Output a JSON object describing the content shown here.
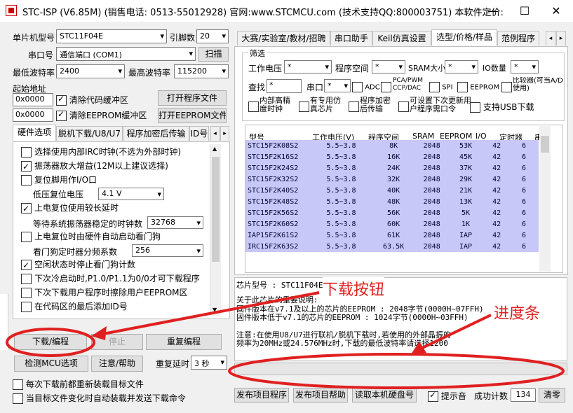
{
  "window": {
    "title": "STC-ISP (V6.85M) (销售电话: 0513-55012928) 官网:www.STCMCU.com (技术支持QQ:800003751) 本软件定价:",
    "min": "—",
    "max": "☐",
    "close": "✕"
  },
  "left": {
    "mcu_label": "单片机型号",
    "mcu_value": "STC11F04E",
    "pins_label": "引脚数",
    "pins_value": "20",
    "port_label": "串口号",
    "port_value": "通信端口 (COM1)",
    "scan": "扫描",
    "min_baud_label": "最低波特率",
    "min_baud_value": "2400",
    "max_baud_label": "最高波特率",
    "max_baud_value": "115200",
    "start_addr_label": "起始地址",
    "addr1": "0x0000",
    "clear_code": "清除代码缓冲区",
    "open_prog": "打开程序文件",
    "addr2": "0x0000",
    "clear_eeprom": "清除EEPROM缓冲区",
    "open_eeprom": "打开EEPROM文件",
    "tabs": [
      "硬件选项",
      "脱机下载/U8/U7",
      "程序加密后传输",
      "ID号"
    ],
    "options": [
      {
        "text": "选择使用内部IRC时钟(不选为外部时钟)",
        "checked": false
      },
      {
        "text": "振荡器放大增益(12M以上建议选择)",
        "checked": true
      },
      {
        "text": "复位脚用作I/O口",
        "checked": false
      },
      {
        "text": "上电复位使用较长延时",
        "checked": true
      },
      {
        "text": "上电复位时由硬件自动启动看门狗",
        "checked": false
      },
      {
        "text": "空闲状态时停止看门狗计数",
        "checked": true
      },
      {
        "text": "下次冷启动时,P1.0/P1.1为0/0才可下载程序",
        "checked": false
      },
      {
        "text": "下次下载用户程序时擦除用户EEPROM区",
        "checked": false
      },
      {
        "text": "在代码区的最后添加ID号",
        "checked": false
      }
    ],
    "low_reset_label": "低压复位电压",
    "low_reset_value": "4.1 V",
    "wait_label": "等待系统振荡器稳定的时钟数",
    "wait_value": "32768",
    "wdt_label": "看门狗定时器分频系数",
    "wdt_value": "256",
    "download": "下载/编程",
    "stop": "停止",
    "reprogram": "重复编程",
    "detect": "检测MCU选项",
    "help": "注意/帮助",
    "delay_label": "重复延时",
    "delay_value": "3 秒",
    "reload_each": "每次下载前都重新装载目标文件",
    "auto_download": "当目标文件变化时自动装载并发送下载命令"
  },
  "right": {
    "tabs": [
      "大赛/实验室/教材/招聘",
      "串口助手",
      "Keil仿真设置",
      "选型/价格/样品",
      "范例程序"
    ],
    "filter": {
      "legend": "筛选",
      "voltage": "工作电压",
      "space": "程序空间",
      "sram": "SRAM大小",
      "io": "IO数量",
      "star": "*",
      "find": "查找",
      "uart": "串口",
      "adc": "ADC",
      "pca": "PCA/PWM CCP/DAC",
      "spi": "SPI",
      "eeprom": "EEPROM",
      "cmp": "比较器(可当A/D使用)",
      "irc": "内部高精度时钟",
      "emu": "有专用仿真芯片",
      "enc": "程序加密后传输",
      "user_id": "可设置下次更新用户程序需口令",
      "usb": "支持USB下载"
    },
    "table": {
      "headers": [
        "型号",
        "工作电压(V)",
        "程序空间",
        "SRAM",
        "EEPROM",
        "I/O",
        "定时器",
        "串"
      ],
      "rows": [
        [
          "STC15F2K08S2",
          "5.5~3.8",
          "8K",
          "2048",
          "53K",
          "42",
          "6"
        ],
        [
          "STC15F2K16S2",
          "5.5~3.8",
          "16K",
          "2048",
          "45K",
          "42",
          "6"
        ],
        [
          "STC15F2K24S2",
          "5.5~3.8",
          "24K",
          "2048",
          "37K",
          "42",
          "6"
        ],
        [
          "STC15F2K32S2",
          "5.5~3.8",
          "32K",
          "2048",
          "29K",
          "42",
          "6"
        ],
        [
          "STC15F2K40S2",
          "5.5~3.8",
          "40K",
          "2048",
          "21K",
          "42",
          "6"
        ],
        [
          "STC15F2K48S2",
          "5.5~3.8",
          "48K",
          "2048",
          "13K",
          "42",
          "6"
        ],
        [
          "STC15F2K56S2",
          "5.5~3.8",
          "56K",
          "2048",
          "5K",
          "42",
          "6"
        ],
        [
          "STC15F2K60S2",
          "5.5~3.8",
          "60K",
          "2048",
          "1K",
          "42",
          "6"
        ],
        [
          "IAP15F2K61S2",
          "5.5~3.8",
          "61K",
          "2048",
          "IAP",
          "42",
          "6"
        ],
        [
          "IRC15F2K63S2",
          "5.5~3.8",
          "63.5K",
          "2048",
          "IAP",
          "42",
          "6"
        ]
      ]
    },
    "info": {
      "line1": "芯片型号 : STC11F04E",
      "line2": "关于此芯片的重要说明:",
      "line3": "  固件版本在v7.1及以上的芯片的EEPROM : 2048字节(0000H~07FFH)",
      "line4": "  固件版本低于v7.1的芯片的EEPROM     : 1024字节(0000H~03FFH)",
      "line5": "注意:在使用U8/U7进行联机/脱机下载时,若使用的外部晶振的",
      "line6": "     频率为20MHz或24.576MHz时,下载的最低波特率请选择1200"
    },
    "publish_prog": "发布项目程序",
    "publish_help": "发布项目帮助",
    "read_disk": "读取本机硬盘号",
    "prompt": "提示音",
    "success_label": "成功计数",
    "success_count": "134",
    "clear": "清零"
  },
  "annotations": {
    "download_button": "下载按钮",
    "progress_bar": "进度条"
  },
  "colors": {
    "annotation_red": "#e02020",
    "row_highlight": "#c8c8f8"
  }
}
